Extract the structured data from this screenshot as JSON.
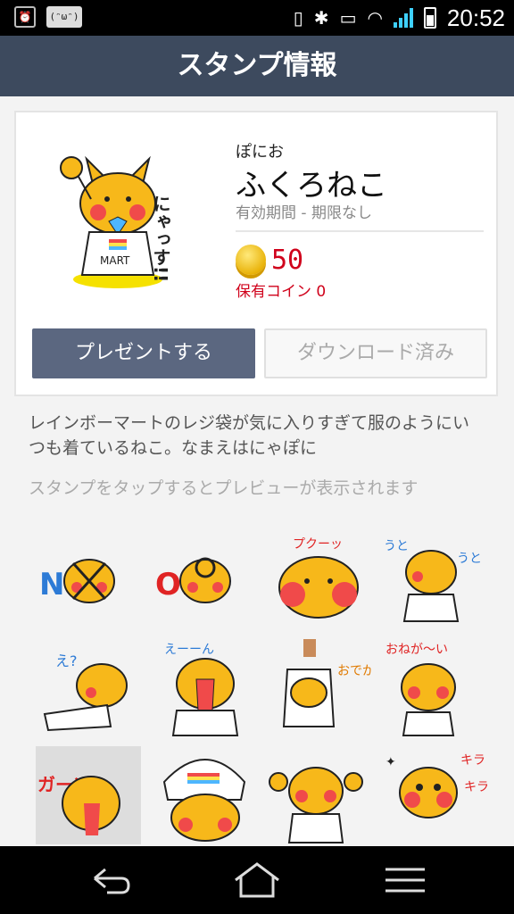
{
  "status_bar": {
    "face_badge": "(ᵔωᵔ)",
    "time": "20:52"
  },
  "header": {
    "title": "スタンプ情報"
  },
  "pack": {
    "author": "ぽにお",
    "name": "ふくろねこ",
    "validity": "有効期間 - 期限なし",
    "price": "50",
    "owned_coins": "保有コイン 0",
    "present_label": "プレゼントする",
    "download_label": "ダウンロード済み",
    "sticker_texts": {
      "main": "にゃっす!!",
      "s1": "NO!",
      "s2": "OK!",
      "s3": "プクーッ",
      "s4": "うと うと",
      "s5": "え?",
      "s6": "えーーん",
      "s7": "おでかけ中",
      "s8": "おねが〜い",
      "s9": "ガーン",
      "s10": "",
      "s11": "",
      "s12": "キラ キラ"
    }
  },
  "description": "レインボーマートのレジ袋が気に入りすぎて服のようにいつも着ているねこ。なまえはにゃぽに",
  "hint": "スタンプをタップするとプレビューが表示されます",
  "colors": {
    "header_bg": "#3d4a5e",
    "primary_button": "#5b6780",
    "price_red": "#d0021b",
    "cat_yellow": "#f7b81a"
  },
  "icons": {
    "back": "back-icon",
    "home": "home-icon",
    "menu": "menu-icon"
  }
}
